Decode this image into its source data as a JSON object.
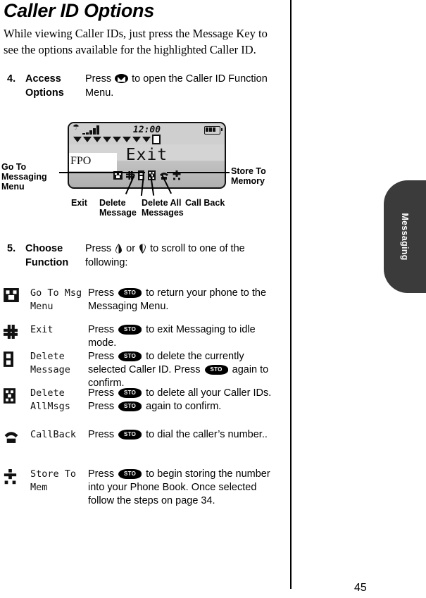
{
  "document": {
    "heading": "Caller ID Options",
    "intro": "While viewing Caller IDs, just press the Message Key to see the options available for the highlighted Caller ID.",
    "page_number": "45",
    "side_tab_label": "Messaging"
  },
  "steps": [
    {
      "number": "4.",
      "title_line1": "Access",
      "title_line2": "Options",
      "body_pre": "Press",
      "body_post": "to open the Caller ID Function Menu.",
      "key_icon": "message-key-icon"
    },
    {
      "number": "5.",
      "title_line1": "Choose",
      "title_line2": "Function",
      "body_pre": "Press",
      "body_mid": "or",
      "body_post": "to scroll to one of the following:",
      "up_icon": "scroll-up-icon",
      "down_icon": "scroll-down-icon"
    }
  ],
  "figure": {
    "placeholder_text": "FPO",
    "lcd": {
      "clock": "12:00",
      "menu_title": "Exit",
      "signal_icon": "antenna-signal-icon",
      "battery_icon": "battery-icon",
      "signal_bar_count": 5,
      "marker_count": 8
    },
    "callouts": {
      "left": "Go To\nMessaging\nMenu",
      "left_line1": "Go To",
      "left_line2": "Messaging",
      "left_line3": "Menu",
      "right_line1": "Store To",
      "right_line2": "Memory",
      "bottom": [
        {
          "line1": "Exit",
          "line2": ""
        },
        {
          "line1": "Delete",
          "line2": "Message"
        },
        {
          "line1": "Delete All",
          "line2": "Messages"
        },
        {
          "line1": "Call Back",
          "line2": ""
        }
      ]
    },
    "icon_names": [
      "go-to-messaging-menu-icon",
      "exit-icon",
      "delete-message-icon",
      "delete-all-messages-icon",
      "call-back-icon",
      "store-to-memory-icon"
    ]
  },
  "options": [
    {
      "icon": "go-to-messaging-menu-icon",
      "label_line1": "Go To Msg",
      "label_line2": "Menu",
      "desc_pre": "Press",
      "desc_post": "to return your phone to the Messaging Menu."
    },
    {
      "icon": "exit-icon",
      "label_line1": "Exit",
      "label_line2": "",
      "desc_pre": "Press",
      "desc_post": "to exit Messaging to idle mode."
    },
    {
      "icon": "delete-message-icon",
      "label_line1": "Delete",
      "label_line2": "Message",
      "desc_pre": "Press",
      "desc_mid": "to delete the currently selected Caller ID. Press",
      "desc_post": "again to confirm."
    },
    {
      "icon": "delete-all-messages-icon",
      "label_line1": "Delete",
      "label_line2": "AllMsgs",
      "desc_pre": "Press",
      "desc_mid": "to delete all your Caller IDs. Press",
      "desc_post": "again to confirm."
    },
    {
      "icon": "call-back-icon",
      "label_line1": "CallBack",
      "label_line2": "",
      "desc_pre": "Press",
      "desc_post": "to dial the caller’s number.."
    },
    {
      "icon": "store-to-memory-icon",
      "label_line1": "Store To",
      "label_line2": "Mem",
      "desc_pre": "Press",
      "desc_post": "to begin storing the number into your Phone Book. Once selected follow the steps on page 34."
    }
  ],
  "colors": {
    "tab_background": "#3b3b3b",
    "lcd_background": "#d4d4d4",
    "ink": "#000000"
  }
}
